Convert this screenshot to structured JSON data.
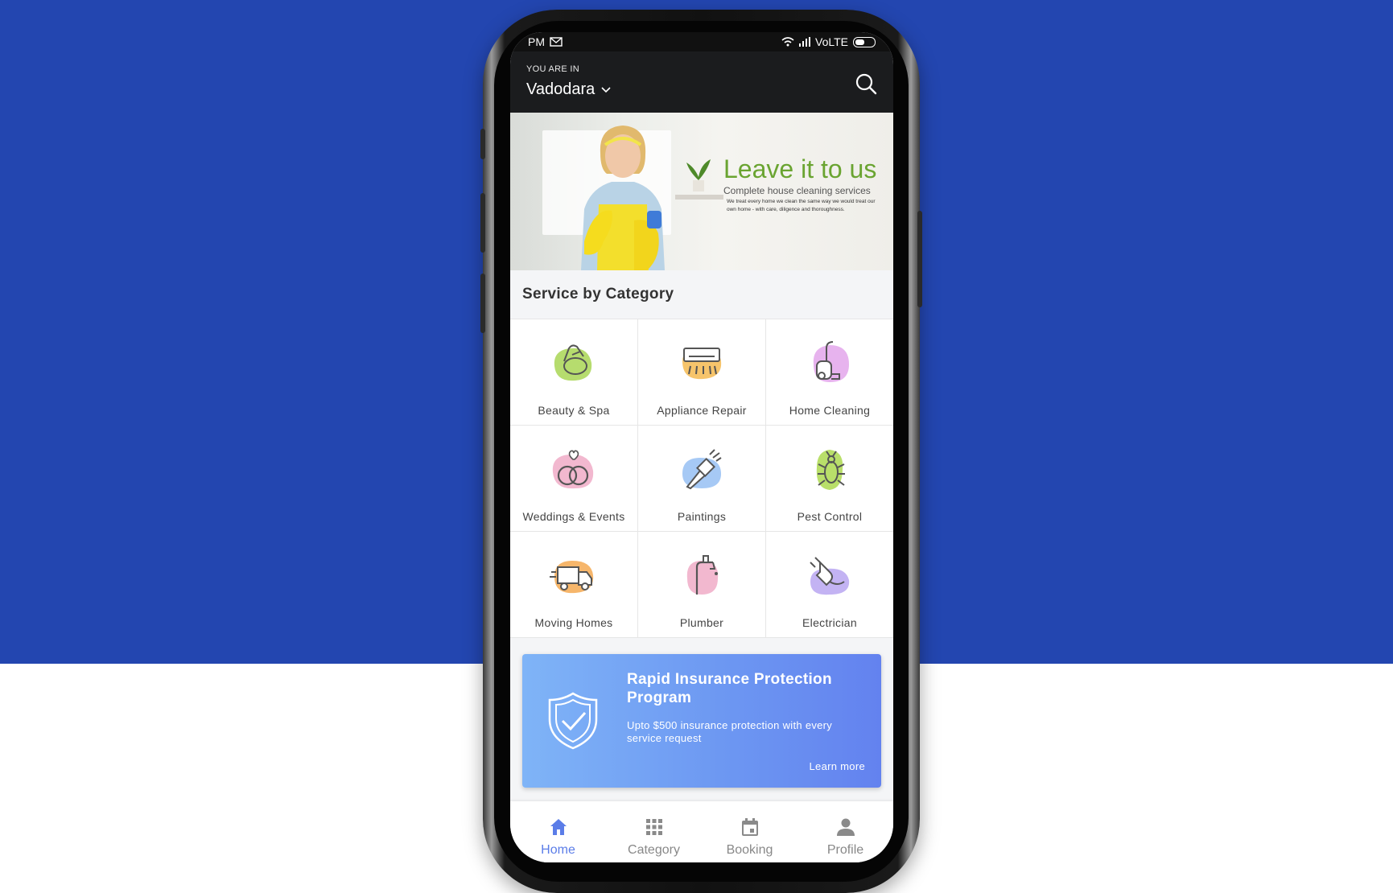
{
  "status_bar": {
    "time": "PM",
    "network": "VoLTE"
  },
  "header": {
    "location_caption": "YOU ARE IN",
    "city": "Vadodara"
  },
  "banner": {
    "title": "Leave it to us",
    "subtitle": "Complete house cleaning services",
    "description": "We treat every home we clean the same way we would treat our own home - with care, diligence and thoroughness."
  },
  "section": {
    "title": "Service by Category"
  },
  "categories": [
    {
      "label": "Beauty & Spa",
      "icon": "beauty-spa-icon",
      "blob": "#b6dc6e"
    },
    {
      "label": "Appliance Repair",
      "icon": "air-conditioner-icon",
      "blob": "#f6c46b"
    },
    {
      "label": "Home Cleaning",
      "icon": "vacuum-cleaner-icon",
      "blob": "#e7b3ee"
    },
    {
      "label": "Weddings & Events",
      "icon": "wedding-rings-icon",
      "blob": "#f2b8cf"
    },
    {
      "label": "Paintings",
      "icon": "paint-brush-icon",
      "blob": "#a6c9f5"
    },
    {
      "label": "Pest Control",
      "icon": "bug-icon",
      "blob": "#b9df6a"
    },
    {
      "label": "Moving Homes",
      "icon": "moving-truck-icon",
      "blob": "#f6b66b"
    },
    {
      "label": "Plumber",
      "icon": "faucet-icon",
      "blob": "#f2b8cf"
    },
    {
      "label": "Electrician",
      "icon": "plug-icon",
      "blob": "#c3b3f3"
    }
  ],
  "promo": {
    "title": "Rapid Insurance Protection Program",
    "description": "Upto $500 insurance protection with every service request",
    "link": "Learn more"
  },
  "bottom_nav": [
    {
      "label": "Home",
      "icon": "home-icon",
      "active": true
    },
    {
      "label": "Category",
      "icon": "grid-icon",
      "active": false
    },
    {
      "label": "Booking",
      "icon": "calendar-icon",
      "active": false
    },
    {
      "label": "Profile",
      "icon": "person-icon",
      "active": false
    }
  ],
  "colors": {
    "background_top": "#2346b0",
    "accent": "#5b7de8",
    "header": "#1b1c1e",
    "banner_title": "#6aa431"
  }
}
